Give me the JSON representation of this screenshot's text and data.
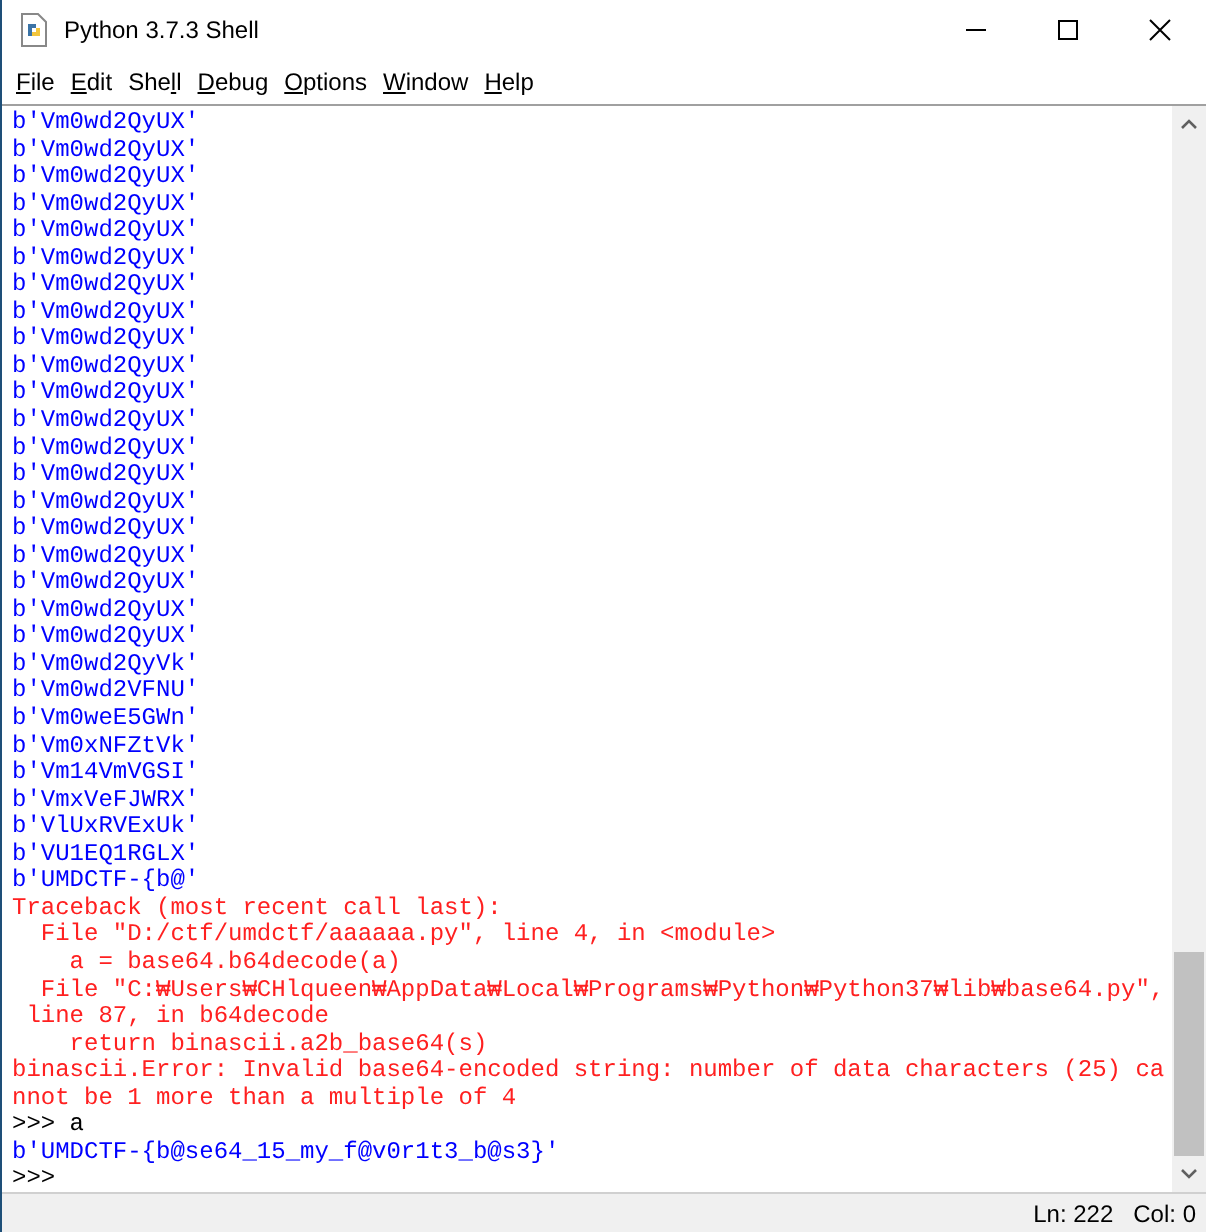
{
  "window": {
    "title": "Python 3.7.3 Shell"
  },
  "menu": [
    {
      "key": "F",
      "after": "ile"
    },
    {
      "key": "E",
      "after": "dit"
    },
    {
      "before": "She",
      "key": "l",
      "after": "l"
    },
    {
      "key": "D",
      "after": "ebug"
    },
    {
      "key": "O",
      "after": "ptions"
    },
    {
      "key": "W",
      "after": "indow"
    },
    {
      "key": "H",
      "after": "elp"
    }
  ],
  "shell_lines": [
    {
      "kind": "output",
      "text": "b'Vm0wd2QyUX'"
    },
    {
      "kind": "output",
      "text": "b'Vm0wd2QyUX'"
    },
    {
      "kind": "output",
      "text": "b'Vm0wd2QyUX'"
    },
    {
      "kind": "output",
      "text": "b'Vm0wd2QyUX'"
    },
    {
      "kind": "output",
      "text": "b'Vm0wd2QyUX'"
    },
    {
      "kind": "output",
      "text": "b'Vm0wd2QyUX'"
    },
    {
      "kind": "output",
      "text": "b'Vm0wd2QyUX'"
    },
    {
      "kind": "output",
      "text": "b'Vm0wd2QyUX'"
    },
    {
      "kind": "output",
      "text": "b'Vm0wd2QyUX'"
    },
    {
      "kind": "output",
      "text": "b'Vm0wd2QyUX'"
    },
    {
      "kind": "output",
      "text": "b'Vm0wd2QyUX'"
    },
    {
      "kind": "output",
      "text": "b'Vm0wd2QyUX'"
    },
    {
      "kind": "output",
      "text": "b'Vm0wd2QyUX'"
    },
    {
      "kind": "output",
      "text": "b'Vm0wd2QyUX'"
    },
    {
      "kind": "output",
      "text": "b'Vm0wd2QyUX'"
    },
    {
      "kind": "output",
      "text": "b'Vm0wd2QyUX'"
    },
    {
      "kind": "output",
      "text": "b'Vm0wd2QyUX'"
    },
    {
      "kind": "output",
      "text": "b'Vm0wd2QyUX'"
    },
    {
      "kind": "output",
      "text": "b'Vm0wd2QyUX'"
    },
    {
      "kind": "output",
      "text": "b'Vm0wd2QyUX'"
    },
    {
      "kind": "output",
      "text": "b'Vm0wd2QyVk'"
    },
    {
      "kind": "output",
      "text": "b'Vm0wd2VFNU'"
    },
    {
      "kind": "output",
      "text": "b'Vm0weE5GWn'"
    },
    {
      "kind": "output",
      "text": "b'Vm0xNFZtVk'"
    },
    {
      "kind": "output",
      "text": "b'Vm14VmVGSI'"
    },
    {
      "kind": "output",
      "text": "b'VmxVeFJWRX'"
    },
    {
      "kind": "output",
      "text": "b'VlUxRVExUk'"
    },
    {
      "kind": "output",
      "text": "b'VU1EQ1RGLX'"
    },
    {
      "kind": "output",
      "text": "b'UMDCTF-{b@'"
    },
    {
      "kind": "error",
      "text": "Traceback (most recent call last):"
    },
    {
      "kind": "error",
      "text": "  File \"D:/ctf/umdctf/aaaaaa.py\", line 4, in <module>"
    },
    {
      "kind": "error",
      "text": "    a = base64.b64decode(a)"
    },
    {
      "kind": "error",
      "text": "  File \"C:₩Users₩CHlqueen₩AppData₩Local₩Programs₩Python₩Python37₩lib₩base64.py\","
    },
    {
      "kind": "error",
      "text": " line 87, in b64decode"
    },
    {
      "kind": "error",
      "text": "    return binascii.a2b_base64(s)"
    },
    {
      "kind": "error",
      "text": "binascii.Error: Invalid base64-encoded string: number of data characters (25) ca"
    },
    {
      "kind": "error",
      "text": "nnot be 1 more than a multiple of 4"
    },
    {
      "kind": "input",
      "text": ">>> a"
    },
    {
      "kind": "output",
      "text": "b'UMDCTF-{b@se64_15_my_f@v0r1t3_b@s3}'"
    },
    {
      "kind": "input",
      "text": ">>>"
    }
  ],
  "status_bar": {
    "line": "Ln: 222",
    "column": "Col: 0"
  }
}
